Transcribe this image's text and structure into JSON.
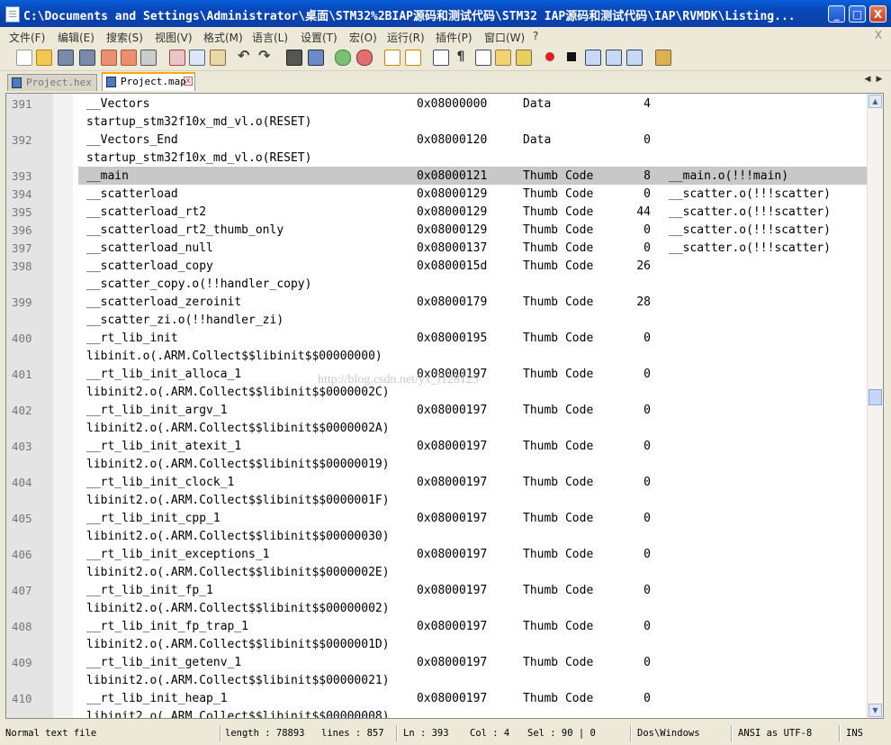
{
  "window": {
    "title": "C:\\Documents and Settings\\Administrator\\桌面\\STM32%2BIAP源码和测试代码\\STM32 IAP源码和测试代码\\IAP\\RVMDK\\Listing...",
    "minimize": "_",
    "maximize": "□",
    "close": "X"
  },
  "menu": {
    "items": [
      "文件(F)",
      "编辑(E)",
      "搜索(S)",
      "视图(V)",
      "格式(M)",
      "语言(L)",
      "设置(T)",
      "宏(O)",
      "运行(R)",
      "插件(P)",
      "窗口(W)",
      "?"
    ],
    "close_x": "X"
  },
  "toolbar": {
    "buttons": [
      "new-file",
      "open-file",
      "save",
      "save-all",
      "close",
      "close-all",
      "print",
      "cut",
      "copy",
      "paste",
      "undo",
      "redo",
      "find",
      "replace",
      "zoom-in",
      "zoom-out",
      "sync-vertical",
      "sync-horizontal",
      "word-wrap",
      "show-all-chars",
      "indent-guide",
      "user-lang",
      "doc-map",
      "record-macro",
      "stop-macro",
      "play-macro",
      "run-macro-multiple",
      "save-macro",
      "launch-browser"
    ]
  },
  "tabs": [
    {
      "label": "Project.hex",
      "active": false
    },
    {
      "label": "Project.map",
      "active": true
    }
  ],
  "editor": {
    "watermark": "http://blog.csdn.net/yx_l128125",
    "highlight_line": 393,
    "rows": [
      {
        "num": "391",
        "name": "__Vectors",
        "addr": "0x08000000",
        "type": "Data",
        "size": "4",
        "obj": ""
      },
      {
        "num": "",
        "name": "startup_stm32f10x_md_vl.o(RESET)",
        "addr": "",
        "type": "",
        "size": "",
        "obj": ""
      },
      {
        "num": "392",
        "name": "__Vectors_End",
        "addr": "0x08000120",
        "type": "Data",
        "size": "0",
        "obj": ""
      },
      {
        "num": "",
        "name": "startup_stm32f10x_md_vl.o(RESET)",
        "addr": "",
        "type": "",
        "size": "",
        "obj": ""
      },
      {
        "num": "393",
        "name": "__main",
        "addr": "0x08000121",
        "type": "Thumb Code",
        "size": "8",
        "obj": "__main.o(!!!main)"
      },
      {
        "num": "394",
        "name": "__scatterload",
        "addr": "0x08000129",
        "type": "Thumb Code",
        "size": "0",
        "obj": "__scatter.o(!!!scatter)"
      },
      {
        "num": "395",
        "name": "__scatterload_rt2",
        "addr": "0x08000129",
        "type": "Thumb Code",
        "size": "44",
        "obj": "__scatter.o(!!!scatter)"
      },
      {
        "num": "396",
        "name": "__scatterload_rt2_thumb_only",
        "addr": "0x08000129",
        "type": "Thumb Code",
        "size": "0",
        "obj": "__scatter.o(!!!scatter)"
      },
      {
        "num": "397",
        "name": "__scatterload_null",
        "addr": "0x08000137",
        "type": "Thumb Code",
        "size": "0",
        "obj": "__scatter.o(!!!scatter)"
      },
      {
        "num": "398",
        "name": "__scatterload_copy",
        "addr": "0x0800015d",
        "type": "Thumb Code",
        "size": "26",
        "obj": ""
      },
      {
        "num": "",
        "name": "__scatter_copy.o(!!handler_copy)",
        "addr": "",
        "type": "",
        "size": "",
        "obj": ""
      },
      {
        "num": "399",
        "name": "__scatterload_zeroinit",
        "addr": "0x08000179",
        "type": "Thumb Code",
        "size": "28",
        "obj": ""
      },
      {
        "num": "",
        "name": "__scatter_zi.o(!!handler_zi)",
        "addr": "",
        "type": "",
        "size": "",
        "obj": ""
      },
      {
        "num": "400",
        "name": "__rt_lib_init",
        "addr": "0x08000195",
        "type": "Thumb Code",
        "size": "0",
        "obj": ""
      },
      {
        "num": "",
        "name": "libinit.o(.ARM.Collect$$libinit$$00000000)",
        "addr": "",
        "type": "",
        "size": "",
        "obj": ""
      },
      {
        "num": "401",
        "name": "__rt_lib_init_alloca_1",
        "addr": "0x08000197",
        "type": "Thumb Code",
        "size": "0",
        "obj": ""
      },
      {
        "num": "",
        "name": "libinit2.o(.ARM.Collect$$libinit$$0000002C)",
        "addr": "",
        "type": "",
        "size": "",
        "obj": ""
      },
      {
        "num": "402",
        "name": "__rt_lib_init_argv_1",
        "addr": "0x08000197",
        "type": "Thumb Code",
        "size": "0",
        "obj": ""
      },
      {
        "num": "",
        "name": "libinit2.o(.ARM.Collect$$libinit$$0000002A)",
        "addr": "",
        "type": "",
        "size": "",
        "obj": ""
      },
      {
        "num": "403",
        "name": "__rt_lib_init_atexit_1",
        "addr": "0x08000197",
        "type": "Thumb Code",
        "size": "0",
        "obj": ""
      },
      {
        "num": "",
        "name": "libinit2.o(.ARM.Collect$$libinit$$00000019)",
        "addr": "",
        "type": "",
        "size": "",
        "obj": ""
      },
      {
        "num": "404",
        "name": "__rt_lib_init_clock_1",
        "addr": "0x08000197",
        "type": "Thumb Code",
        "size": "0",
        "obj": ""
      },
      {
        "num": "",
        "name": "libinit2.o(.ARM.Collect$$libinit$$0000001F)",
        "addr": "",
        "type": "",
        "size": "",
        "obj": ""
      },
      {
        "num": "405",
        "name": "__rt_lib_init_cpp_1",
        "addr": "0x08000197",
        "type": "Thumb Code",
        "size": "0",
        "obj": ""
      },
      {
        "num": "",
        "name": "libinit2.o(.ARM.Collect$$libinit$$00000030)",
        "addr": "",
        "type": "",
        "size": "",
        "obj": ""
      },
      {
        "num": "406",
        "name": "__rt_lib_init_exceptions_1",
        "addr": "0x08000197",
        "type": "Thumb Code",
        "size": "0",
        "obj": ""
      },
      {
        "num": "",
        "name": "libinit2.o(.ARM.Collect$$libinit$$0000002E)",
        "addr": "",
        "type": "",
        "size": "",
        "obj": ""
      },
      {
        "num": "407",
        "name": "__rt_lib_init_fp_1",
        "addr": "0x08000197",
        "type": "Thumb Code",
        "size": "0",
        "obj": ""
      },
      {
        "num": "",
        "name": "libinit2.o(.ARM.Collect$$libinit$$00000002)",
        "addr": "",
        "type": "",
        "size": "",
        "obj": ""
      },
      {
        "num": "408",
        "name": "__rt_lib_init_fp_trap_1",
        "addr": "0x08000197",
        "type": "Thumb Code",
        "size": "0",
        "obj": ""
      },
      {
        "num": "",
        "name": "libinit2.o(.ARM.Collect$$libinit$$0000001D)",
        "addr": "",
        "type": "",
        "size": "",
        "obj": ""
      },
      {
        "num": "409",
        "name": "__rt_lib_init_getenv_1",
        "addr": "0x08000197",
        "type": "Thumb Code",
        "size": "0",
        "obj": ""
      },
      {
        "num": "",
        "name": "libinit2.o(.ARM.Collect$$libinit$$00000021)",
        "addr": "",
        "type": "",
        "size": "",
        "obj": ""
      },
      {
        "num": "410",
        "name": "__rt_lib_init_heap_1",
        "addr": "0x08000197",
        "type": "Thumb Code",
        "size": "0",
        "obj": ""
      },
      {
        "num": "",
        "name": "libinit2.o(.ARM.Collect$$libinit$$00000008)",
        "addr": "",
        "type": "",
        "size": "",
        "obj": ""
      }
    ]
  },
  "status": {
    "file_type": "Normal text file",
    "length": "length : 78893",
    "lines": "lines : 857",
    "ln": "Ln : 393",
    "col": "Col : 4",
    "sel": "Sel : 90 | 0",
    "eol": "Dos\\Windows",
    "encoding": "ANSI as UTF-8",
    "mode": "INS"
  }
}
